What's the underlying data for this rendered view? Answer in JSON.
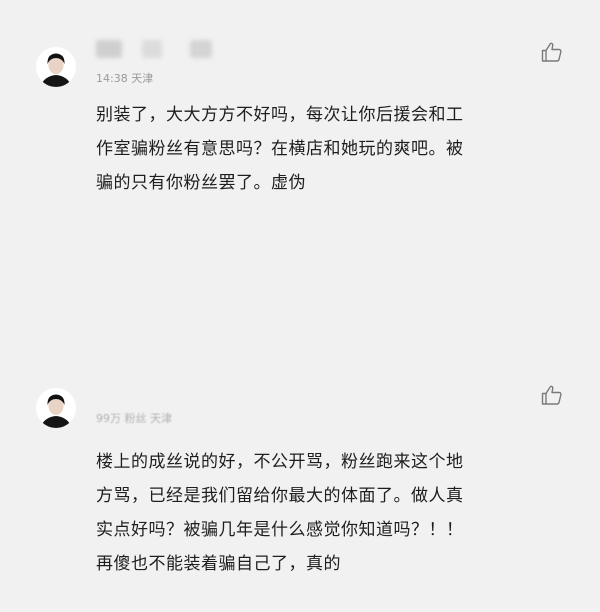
{
  "comments": [
    {
      "time": "14:38",
      "location": "天津",
      "lines": [
        "别装了，大大方方不好吗，每次让你后援会和工",
        "作室骗粉丝有意思吗？在横店和她玩的爽吧。被",
        "骗的只有你粉丝罢了。虚伪"
      ]
    },
    {
      "meta": "99万 粉丝 天津",
      "lines": [
        "楼上的成丝说的好，不公开骂，粉丝跑来这个地",
        "方骂，已经是我们留给你最大的体面了。做人真",
        "实点好吗？被骗几年是什么感觉你知道吗？！！",
        "再傻也不能装着骗自己了，真的"
      ]
    }
  ],
  "icons": {
    "avatar": "user-avatar",
    "like": "thumbs-up-icon"
  }
}
